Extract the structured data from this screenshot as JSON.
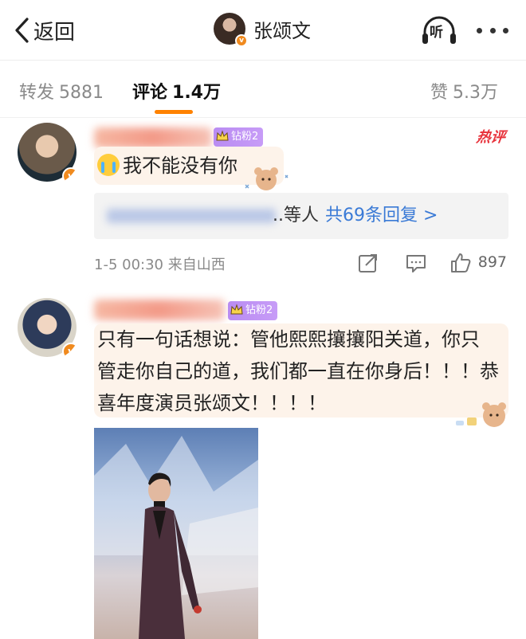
{
  "nav": {
    "back_label": "返回",
    "title": "张颂文",
    "listen_label": "听"
  },
  "tabs": {
    "repost": {
      "label": "转发",
      "count": "5881"
    },
    "comments": {
      "label": "评论",
      "count": "1.4万"
    },
    "likes": {
      "label": "赞",
      "count": "5.3万"
    }
  },
  "comments": [
    {
      "fan_badge": "钻粉2",
      "hot_tag": "热评",
      "text": "我不能没有你",
      "replies_prefix": "..等人",
      "replies_link": "共69条回复 >",
      "meta": "1-5 00:30 来自山西",
      "like_count": "897"
    },
    {
      "fan_badge": "钻粉2",
      "text_lines": [
        "只有一句话想说：管他熙熙攘攘阳关道，你只",
        "管走你自己的道，我们都一直在你身后！！！恭",
        "喜年度演员张颂文！！！！"
      ]
    }
  ],
  "colors": {
    "accent": "#ff8200",
    "link": "#3a7ad6",
    "hot": "#e8333c",
    "fan_badge": "#b98cf2",
    "bubble_bg": "#fdf3ea",
    "verified": "#f08a1e"
  },
  "icons": [
    "chevron-left-icon",
    "headphones-icon",
    "more-icon",
    "share-icon",
    "comment-icon",
    "like-icon",
    "crown-icon",
    "verified-icon",
    "crying-emoji-icon",
    "bear-sticker-icon"
  ]
}
